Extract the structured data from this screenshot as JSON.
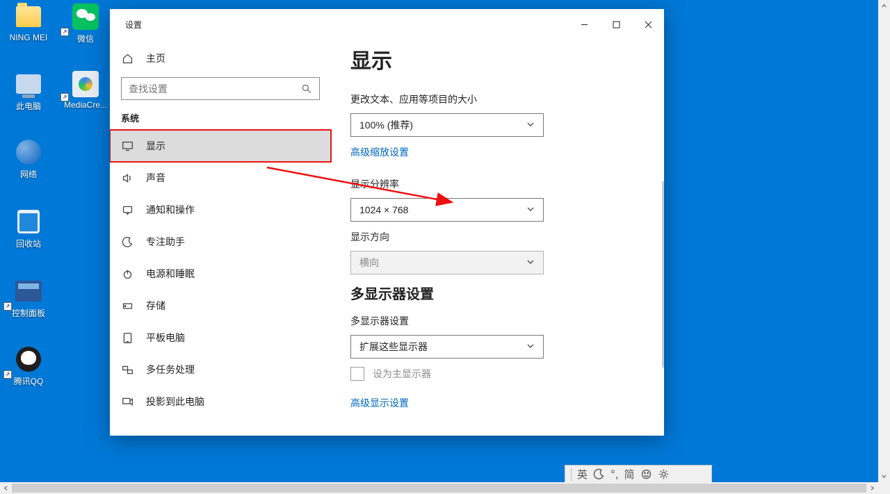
{
  "desktop_icons": [
    {
      "name": "folder",
      "label": "NING MEI"
    },
    {
      "name": "wechat",
      "label": "微信"
    },
    {
      "name": "thispc",
      "label": "此电脑"
    },
    {
      "name": "mediacre",
      "label": "MediaCre..."
    },
    {
      "name": "network",
      "label": "网络"
    },
    {
      "name": "recycle",
      "label": "回收站"
    },
    {
      "name": "controlpanel",
      "label": "控制面板"
    },
    {
      "name": "qq",
      "label": "腾讯QQ"
    }
  ],
  "window": {
    "title": "设置",
    "home_label": "主页",
    "search_placeholder": "查找设置",
    "section_label": "系统",
    "nav_items": [
      {
        "id": "display",
        "label": "显示"
      },
      {
        "id": "sound",
        "label": "声音"
      },
      {
        "id": "notifications",
        "label": "通知和操作"
      },
      {
        "id": "focus",
        "label": "专注助手"
      },
      {
        "id": "power",
        "label": "电源和睡眠"
      },
      {
        "id": "storage",
        "label": "存储"
      },
      {
        "id": "tablet",
        "label": "平板电脑"
      },
      {
        "id": "multitask",
        "label": "多任务处理"
      },
      {
        "id": "projecting",
        "label": "投影到此电脑"
      }
    ]
  },
  "content": {
    "heading": "显示",
    "scale_label": "更改文本、应用等项目的大小",
    "scale_value": "100% (推荐)",
    "advanced_scale_link": "高级缩放设置",
    "resolution_label": "显示分辨率",
    "resolution_value": "1024 × 768",
    "orientation_label": "显示方向",
    "orientation_value": "横向",
    "multi_heading": "多显示器设置",
    "multi_label": "多显示器设置",
    "multi_value": "扩展这些显示器",
    "primary_checkbox_label": "设为主显示器",
    "advanced_display_link": "高级显示设置"
  },
  "ime": {
    "lang": "英",
    "mode": "简"
  },
  "colors": {
    "desktop_bg": "#0078d7",
    "link": "#0067c0",
    "highlight_border": "#e11"
  }
}
